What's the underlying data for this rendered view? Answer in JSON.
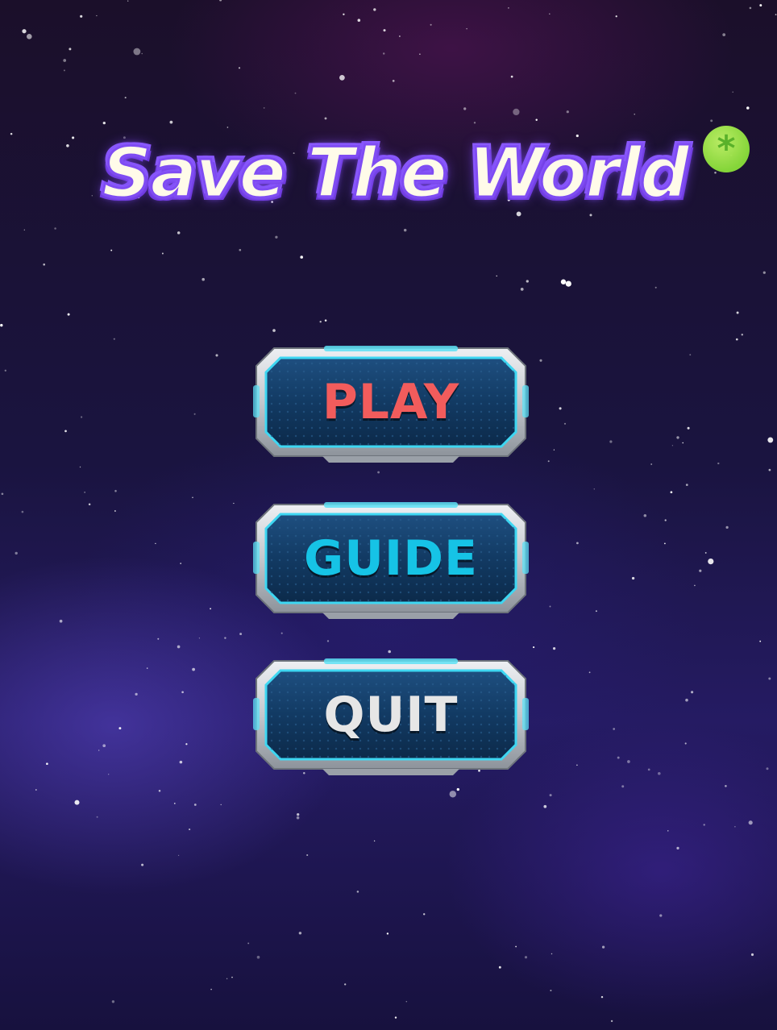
{
  "title": "Save The World",
  "badge": {
    "icon": "asterisk-badge",
    "glyph": "*"
  },
  "menu": {
    "buttons": [
      {
        "label": "PLAY",
        "color": "#f25c5c"
      },
      {
        "label": "GUIDE",
        "color": "#16c3e6"
      },
      {
        "label": "QUIT",
        "color": "#e6e6e6"
      }
    ]
  },
  "colors": {
    "title_fill": "#fffbe9",
    "title_outline": "#7f4cf3",
    "button_frame": "#c9ccd1",
    "button_face": "#123a63",
    "button_glow": "#5de0f5"
  }
}
